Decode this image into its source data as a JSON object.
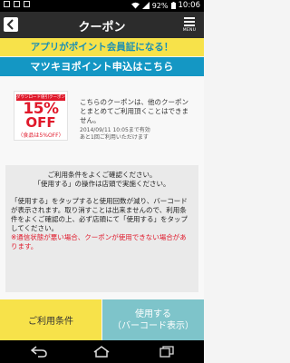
{
  "status_bar": {
    "battery": "92%",
    "time": "10:06"
  },
  "header": {
    "title": "クーポン",
    "menu_label": "MENU"
  },
  "promo_banner": "アプリがポイント会員証になる！",
  "apply_banner": "マツキヨポイント申込はこちら",
  "coupon": {
    "tag": "ダウンロード値引クーポン",
    "percent": "15%",
    "off": "OFF",
    "note": "（食品は5%OFF）",
    "description": "こちらのクーポンは、他のクーポンとまとめてご利用頂くことはできません。",
    "valid_line1": "2014/09/11 10:05まで有効",
    "valid_line2": "あと1回ご利用いただけます",
    "colors": {
      "accent": "#e0192b"
    }
  },
  "terms": {
    "heading_line1": "ご利用条件をよくご確認ください。",
    "heading_line2": "「使用する」の操作は店頭で実施ください。",
    "body": "「使用する」をタップすると使用回数が減り、バーコードが表示されます。取り消すことは出来ませんので、利用条件をよくご確認の上、必ず店頭にて「使用する」をタップしてください。",
    "warning": "※通信状態が悪い場合、クーポンが使用できない場合があります。"
  },
  "buttons": {
    "terms_label": "ご利用条件",
    "use_label_line1": "使用する",
    "use_label_line2": "（バーコード表示）"
  },
  "icons": {
    "back": "back-icon",
    "menu": "menu-icon",
    "nav_back": "nav-back-icon",
    "nav_home": "nav-home-icon",
    "nav_recent": "nav-recent-icon"
  },
  "colors": {
    "header": "#2c2c2c",
    "promo": "#f7e24a",
    "apply": "#1497c4",
    "use_button": "#7ec4ca"
  }
}
